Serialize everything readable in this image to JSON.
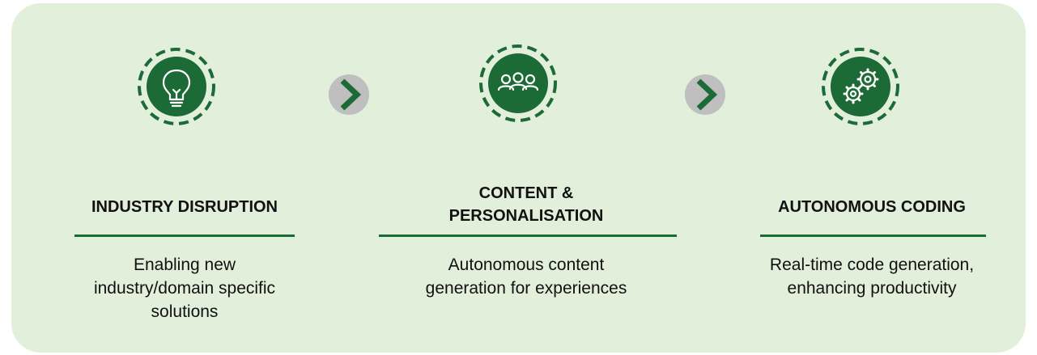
{
  "steps": [
    {
      "icon": "lightbulb-icon",
      "title_lines": [
        "INDUSTRY DISRUPTION"
      ],
      "description_lines": [
        "Enabling new",
        "industry/domain specific",
        "solutions"
      ]
    },
    {
      "icon": "people-group-icon",
      "title_lines": [
        "CONTENT &",
        "PERSONALISATION"
      ],
      "description_lines": [
        "Autonomous content",
        "generation for experiences"
      ]
    },
    {
      "icon": "gears-icon",
      "title_lines": [
        "AUTONOMOUS CODING"
      ],
      "description_lines": [
        "Real-time code generation,",
        "enhancing productivity"
      ]
    }
  ],
  "arrows": [
    "chevron-right-icon",
    "chevron-right-icon"
  ],
  "colors": {
    "background": "#e2efdb",
    "accent_green": "#1c6a36",
    "arrow_bg": "#bfbfbf",
    "text": "#111111"
  }
}
